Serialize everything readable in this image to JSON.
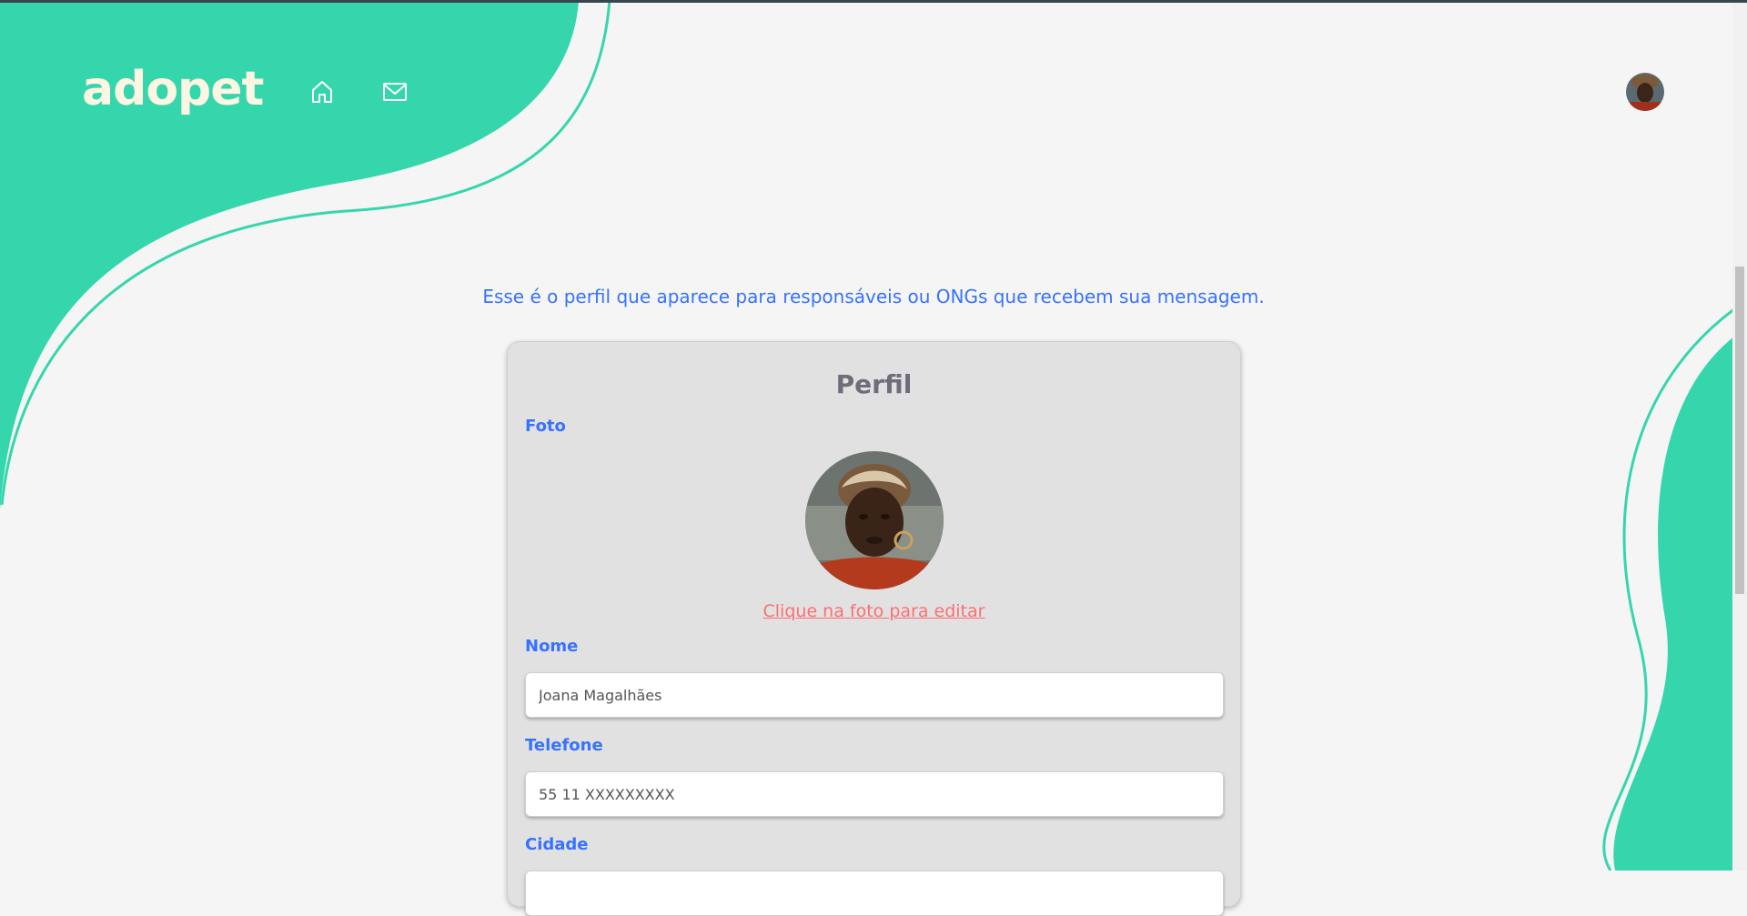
{
  "app": {
    "logo_text": "adopet",
    "nav": [
      {
        "icon": "home-icon"
      },
      {
        "icon": "mail-icon"
      }
    ]
  },
  "colors": {
    "brand_green": "#36D6AD",
    "blue": "#3772FF",
    "coral": "#FC7071",
    "card_bg": "#E1E1E1",
    "title_gray": "#6E6E7A"
  },
  "intro_text": "Esse é o perfil que aparece para responsáveis ou ONGs que recebem sua mensagem.",
  "card": {
    "title": "Perfil",
    "photo_label": "Foto",
    "edit_photo_link": "Clique na foto para editar",
    "name_label": "Nome",
    "name_value": "Joana Magalhães",
    "phone_label": "Telefone",
    "phone_value": "55 11 XXXXXXXXX",
    "city_label": "Cidade"
  }
}
